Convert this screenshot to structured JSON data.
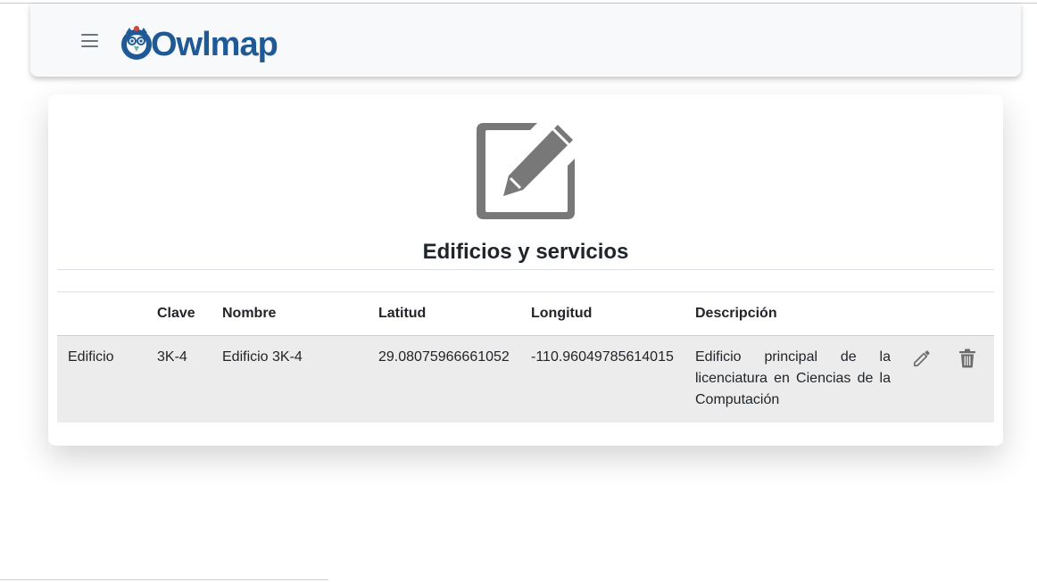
{
  "brand": {
    "name": "Owlmap",
    "primary_color": "#1f5a96"
  },
  "navbar": {
    "menu_icon": "hamburger-icon"
  },
  "card": {
    "icon": "edit-square-icon",
    "title": "Edificios y servicios"
  },
  "table": {
    "headers": [
      "",
      "Clave",
      "Nombre",
      "Latitud",
      "Longitud",
      "Descripción"
    ],
    "rows": [
      {
        "tipo": "Edificio",
        "clave": "3K-4",
        "nombre": "Edificio 3K-4",
        "latitud": "29.08075966661052",
        "longitud": "-110.96049785614015",
        "descripcion": "Edificio principal de la licenciatura en Ciencias de la Computación",
        "actions": [
          "pencil-icon",
          "trash-icon"
        ]
      }
    ]
  }
}
